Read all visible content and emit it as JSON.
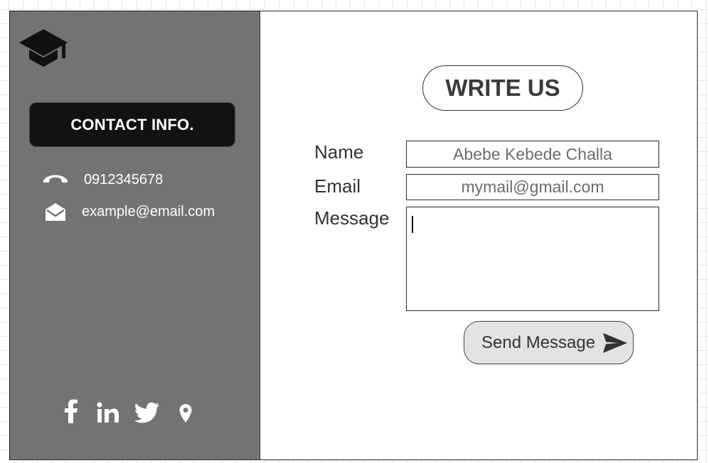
{
  "sidebar": {
    "logo_icon": "graduation-cap-icon",
    "heading": "CONTACT INFO.",
    "phone": {
      "icon": "phone-icon",
      "value": "0912345678"
    },
    "email": {
      "icon": "envelope-open-icon",
      "value": "example@email.com"
    },
    "socials": [
      {
        "icon": "facebook-icon"
      },
      {
        "icon": "linkedin-icon"
      },
      {
        "icon": "twitter-icon"
      },
      {
        "icon": "location-pin-icon"
      }
    ],
    "background_color": "#737373",
    "heading_color": "#121212"
  },
  "form": {
    "title": "WRITE US",
    "name_label": "Name",
    "name_value": "Abebe Kebede Challa",
    "email_label": "Email",
    "email_value": "mymail@gmail.com",
    "message_label": "Message",
    "message_value": "",
    "send_label": "Send Message",
    "send_icon": "paper-plane-icon",
    "button_color": "#e3e3e3"
  }
}
